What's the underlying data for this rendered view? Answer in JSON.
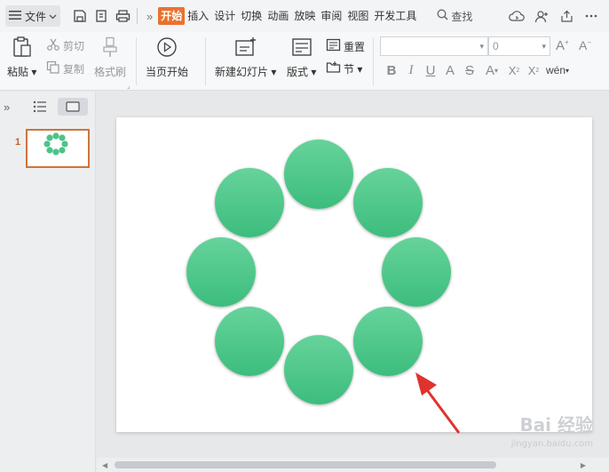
{
  "menubar": {
    "file_label": "文件",
    "tabs": [
      "开始",
      "插入",
      "设计",
      "切换",
      "动画",
      "放映",
      "审阅",
      "视图",
      "开发工具"
    ],
    "active_tab": "开始",
    "search_label": "查找"
  },
  "ribbon": {
    "paste": "粘贴",
    "cut": "剪切",
    "copy": "复制",
    "format_painter": "格式刷",
    "from_current": "当页开始",
    "new_slide": "新建幻灯片",
    "layout": "版式",
    "reset": "重置",
    "section": "节",
    "font_size_value": "0"
  },
  "slide_panel": {
    "slide_number": "1"
  },
  "watermark": {
    "text": "Bai 经验",
    "sub": "jingyan.baidu.com"
  },
  "colors": {
    "accent": "#e8732e",
    "circle_top": "#66d39b",
    "circle_bottom": "#3cbd7d",
    "arrow": "#e0322f"
  }
}
